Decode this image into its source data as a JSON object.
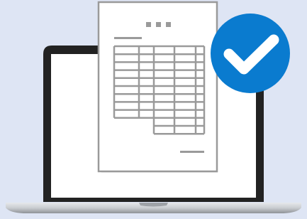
{
  "illustration": {
    "subject": "laptop-with-approved-spreadsheet-document",
    "colors": {
      "background": "#dee5f4",
      "laptop_bezel": "#222222",
      "laptop_screen": "#ffffff",
      "laptop_base": "#cfd2d6",
      "document_paper": "#ffffff",
      "document_stroke": "#9a9a9a",
      "badge_fill": "#0a7bcf",
      "checkmark": "#ffffff"
    },
    "icons": [
      "laptop-icon",
      "document-icon",
      "spreadsheet-table-icon",
      "checkmark-badge-icon"
    ],
    "table": {
      "rows": 11,
      "columns": 5
    }
  }
}
